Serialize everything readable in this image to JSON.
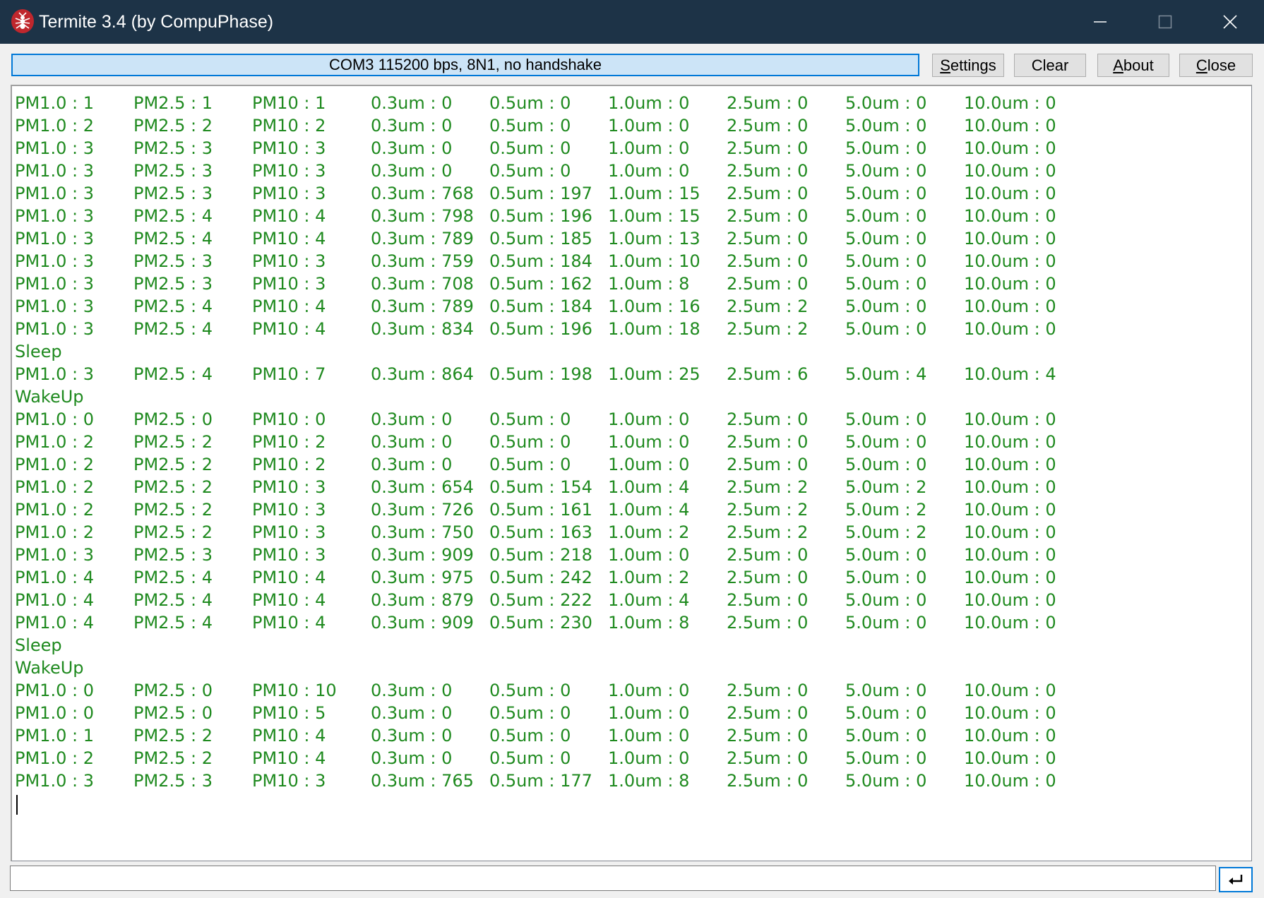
{
  "window": {
    "title": "Termite 3.4 (by CompuPhase)",
    "titlebar_color": "#1d3347",
    "icons": [
      "app-ant-icon",
      "minimize-icon",
      "maximize-icon",
      "close-icon"
    ]
  },
  "toolbar": {
    "status": "COM3 115200 bps, 8N1, no handshake",
    "buttons": [
      {
        "id": "settings",
        "accel": "S",
        "rest": "ettings"
      },
      {
        "id": "clear",
        "accel": "",
        "rest": "Clear"
      },
      {
        "id": "about",
        "accel": "A",
        "rest": "bout"
      },
      {
        "id": "close",
        "accel": "C",
        "rest": "lose"
      }
    ]
  },
  "terminal": {
    "text_color": "#1f8a1f",
    "lines": [
      [
        "PM1.0 : 1",
        "PM2.5 : 1",
        "PM10 : 1",
        "0.3um : 0",
        "0.5um : 0",
        "1.0um : 0",
        "2.5um : 0",
        "5.0um : 0",
        "10.0um : 0"
      ],
      [
        "PM1.0 : 2",
        "PM2.5 : 2",
        "PM10 : 2",
        "0.3um : 0",
        "0.5um : 0",
        "1.0um : 0",
        "2.5um : 0",
        "5.0um : 0",
        "10.0um : 0"
      ],
      [
        "PM1.0 : 3",
        "PM2.5 : 3",
        "PM10 : 3",
        "0.3um : 0",
        "0.5um : 0",
        "1.0um : 0",
        "2.5um : 0",
        "5.0um : 0",
        "10.0um : 0"
      ],
      [
        "PM1.0 : 3",
        "PM2.5 : 3",
        "PM10 : 3",
        "0.3um : 0",
        "0.5um : 0",
        "1.0um : 0",
        "2.5um : 0",
        "5.0um : 0",
        "10.0um : 0"
      ],
      [
        "PM1.0 : 3",
        "PM2.5 : 3",
        "PM10 : 3",
        "0.3um : 768",
        "0.5um : 197",
        "1.0um : 15",
        "2.5um : 0",
        "5.0um : 0",
        "10.0um : 0"
      ],
      [
        "PM1.0 : 3",
        "PM2.5 : 4",
        "PM10 : 4",
        "0.3um : 798",
        "0.5um : 196",
        "1.0um : 15",
        "2.5um : 0",
        "5.0um : 0",
        "10.0um : 0"
      ],
      [
        "PM1.0 : 3",
        "PM2.5 : 4",
        "PM10 : 4",
        "0.3um : 789",
        "0.5um : 185",
        "1.0um : 13",
        "2.5um : 0",
        "5.0um : 0",
        "10.0um : 0"
      ],
      [
        "PM1.0 : 3",
        "PM2.5 : 3",
        "PM10 : 3",
        "0.3um : 759",
        "0.5um : 184",
        "1.0um : 10",
        "2.5um : 0",
        "5.0um : 0",
        "10.0um : 0"
      ],
      [
        "PM1.0 : 3",
        "PM2.5 : 3",
        "PM10 : 3",
        "0.3um : 708",
        "0.5um : 162",
        "1.0um : 8",
        "2.5um : 0",
        "5.0um : 0",
        "10.0um : 0"
      ],
      [
        "PM1.0 : 3",
        "PM2.5 : 4",
        "PM10 : 4",
        "0.3um : 789",
        "0.5um : 184",
        "1.0um : 16",
        "2.5um : 2",
        "5.0um : 0",
        "10.0um : 0"
      ],
      [
        "PM1.0 : 3",
        "PM2.5 : 4",
        "PM10 : 4",
        "0.3um : 834",
        "0.5um : 196",
        "1.0um : 18",
        "2.5um : 2",
        "5.0um : 0",
        "10.0um : 0"
      ],
      [
        "Sleep"
      ],
      [
        "PM1.0 : 3",
        "PM2.5 : 4",
        "PM10 : 7",
        "0.3um : 864",
        "0.5um : 198",
        "1.0um : 25",
        "2.5um : 6",
        "5.0um : 4",
        "10.0um : 4"
      ],
      [
        "WakeUp"
      ],
      [
        "PM1.0 : 0",
        "PM2.5 : 0",
        "PM10 : 0",
        "0.3um : 0",
        "0.5um : 0",
        "1.0um : 0",
        "2.5um : 0",
        "5.0um : 0",
        "10.0um : 0"
      ],
      [
        "PM1.0 : 2",
        "PM2.5 : 2",
        "PM10 : 2",
        "0.3um : 0",
        "0.5um : 0",
        "1.0um : 0",
        "2.5um : 0",
        "5.0um : 0",
        "10.0um : 0"
      ],
      [
        "PM1.0 : 2",
        "PM2.5 : 2",
        "PM10 : 2",
        "0.3um : 0",
        "0.5um : 0",
        "1.0um : 0",
        "2.5um : 0",
        "5.0um : 0",
        "10.0um : 0"
      ],
      [
        "PM1.0 : 2",
        "PM2.5 : 2",
        "PM10 : 3",
        "0.3um : 654",
        "0.5um : 154",
        "1.0um : 4",
        "2.5um : 2",
        "5.0um : 2",
        "10.0um : 0"
      ],
      [
        "PM1.0 : 2",
        "PM2.5 : 2",
        "PM10 : 3",
        "0.3um : 726",
        "0.5um : 161",
        "1.0um : 4",
        "2.5um : 2",
        "5.0um : 2",
        "10.0um : 0"
      ],
      [
        "PM1.0 : 2",
        "PM2.5 : 2",
        "PM10 : 3",
        "0.3um : 750",
        "0.5um : 163",
        "1.0um : 2",
        "2.5um : 2",
        "5.0um : 2",
        "10.0um : 0"
      ],
      [
        "PM1.0 : 3",
        "PM2.5 : 3",
        "PM10 : 3",
        "0.3um : 909",
        "0.5um : 218",
        "1.0um : 0",
        "2.5um : 0",
        "5.0um : 0",
        "10.0um : 0"
      ],
      [
        "PM1.0 : 4",
        "PM2.5 : 4",
        "PM10 : 4",
        "0.3um : 975",
        "0.5um : 242",
        "1.0um : 2",
        "2.5um : 0",
        "5.0um : 0",
        "10.0um : 0"
      ],
      [
        "PM1.0 : 4",
        "PM2.5 : 4",
        "PM10 : 4",
        "0.3um : 879",
        "0.5um : 222",
        "1.0um : 4",
        "2.5um : 0",
        "5.0um : 0",
        "10.0um : 0"
      ],
      [
        "PM1.0 : 4",
        "PM2.5 : 4",
        "PM10 : 4",
        "0.3um : 909",
        "0.5um : 230",
        "1.0um : 8",
        "2.5um : 0",
        "5.0um : 0",
        "10.0um : 0"
      ],
      [
        "Sleep"
      ],
      [
        "WakeUp"
      ],
      [
        "PM1.0 : 0",
        "PM2.5 : 0",
        "PM10 : 10",
        "0.3um : 0",
        "0.5um : 0",
        "1.0um : 0",
        "2.5um : 0",
        "5.0um : 0",
        "10.0um : 0"
      ],
      [
        "PM1.0 : 0",
        "PM2.5 : 0",
        "PM10 : 5",
        "0.3um : 0",
        "0.5um : 0",
        "1.0um : 0",
        "2.5um : 0",
        "5.0um : 0",
        "10.0um : 0"
      ],
      [
        "PM1.0 : 1",
        "PM2.5 : 2",
        "PM10 : 4",
        "0.3um : 0",
        "0.5um : 0",
        "1.0um : 0",
        "2.5um : 0",
        "5.0um : 0",
        "10.0um : 0"
      ],
      [
        "PM1.0 : 2",
        "PM2.5 : 2",
        "PM10 : 4",
        "0.3um : 0",
        "0.5um : 0",
        "1.0um : 0",
        "2.5um : 0",
        "5.0um : 0",
        "10.0um : 0"
      ],
      [
        "PM1.0 : 3",
        "PM2.5 : 3",
        "PM10 : 3",
        "0.3um : 765",
        "0.5um : 177",
        "1.0um : 8",
        "2.5um : 0",
        "5.0um : 0",
        "10.0um : 0"
      ]
    ]
  },
  "input": {
    "value": "",
    "placeholder": ""
  },
  "send_button": {
    "icon": "enter-return-icon"
  }
}
